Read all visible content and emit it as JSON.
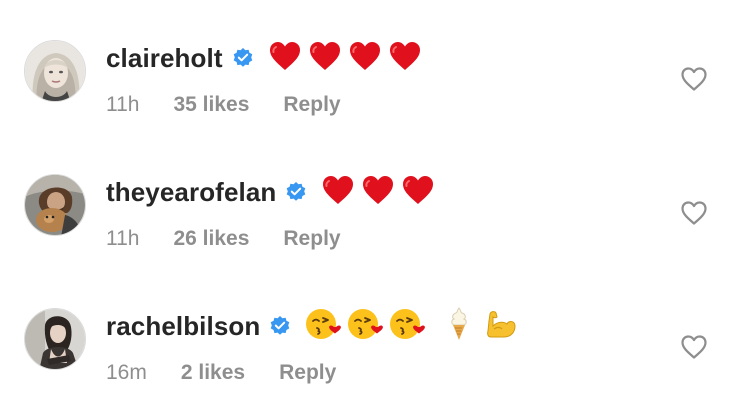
{
  "comments": [
    {
      "username": "claireholt",
      "verified": true,
      "text_emojis": [
        "red-heart",
        "red-heart",
        "red-heart",
        "red-heart"
      ],
      "time": "11h",
      "likes": "35 likes",
      "reply": "Reply"
    },
    {
      "username": "theyearofelan",
      "verified": true,
      "text_emojis": [
        "red-heart",
        "red-heart",
        "red-heart"
      ],
      "time": "11h",
      "likes": "26 likes",
      "reply": "Reply"
    },
    {
      "username": "rachelbilson",
      "verified": true,
      "text_emojis": [
        "kissing-face",
        "kissing-face",
        "kissing-face",
        "soft-ice-cream",
        "flexed-biceps"
      ],
      "time": "16m",
      "likes": "2 likes",
      "reply": "Reply"
    }
  ],
  "icons": {
    "verified_badge": "verified-badge-icon",
    "like": "heart-outline-icon"
  },
  "colors": {
    "username": "#262626",
    "meta": "#8e8e8e",
    "verified_blue": "#3897f0",
    "heart_red": "#e0101d",
    "outline_heart": "#8e8e8e"
  }
}
